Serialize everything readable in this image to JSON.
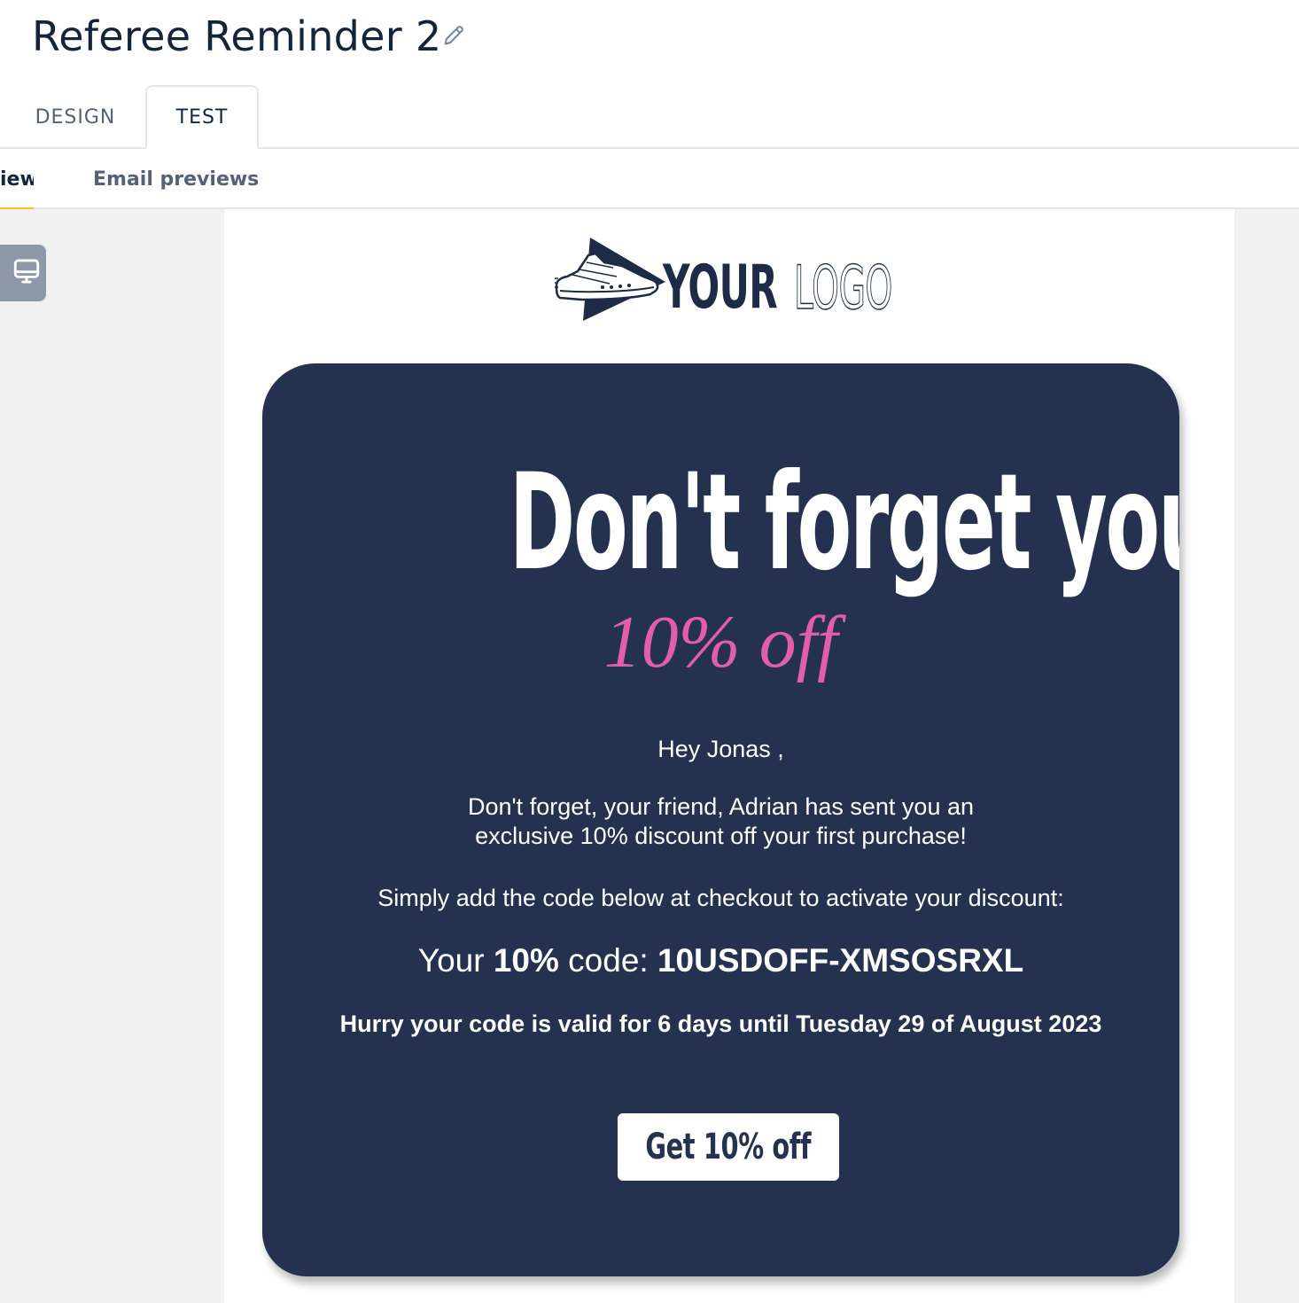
{
  "header": {
    "title": "Referee Reminder 2"
  },
  "tabs": [
    {
      "label": "DESIGN",
      "active": false
    },
    {
      "label": "TEST",
      "active": true
    }
  ],
  "subtabs": {
    "preview_label": "iew",
    "email_previews_label": "Email previews"
  },
  "toolbar": {
    "device_icon": "desktop-monitor-icon"
  },
  "email": {
    "logo": {
      "icon": "sneaker-logo-icon",
      "text_bold": "YOUR",
      "text_light": "LOGO"
    },
    "headline": "Don't forget your",
    "subheadline": "10% off",
    "greeting": "Hey Jonas ,",
    "paragraph_line1": "Don't forget, your friend, Adrian has sent you an",
    "paragraph_line2": "exclusive 10% discount off your first purchase!",
    "instruction": "Simply add the code below at checkout to activate your discount:",
    "code_prefix": "Your ",
    "code_percent": "10%",
    "code_middle": " code: ",
    "code_value": "10USDOFF-XMSOSRXL",
    "validity": "Hurry your code is valid for 6 days until Tuesday 29 of August 2023",
    "cta_label": "Get 10% off"
  },
  "colors": {
    "card_background": "#24314f",
    "accent_pink": "#e05fa8",
    "active_subtab_underline": "#f5c518",
    "canvas_background": "#f1f1f1"
  }
}
